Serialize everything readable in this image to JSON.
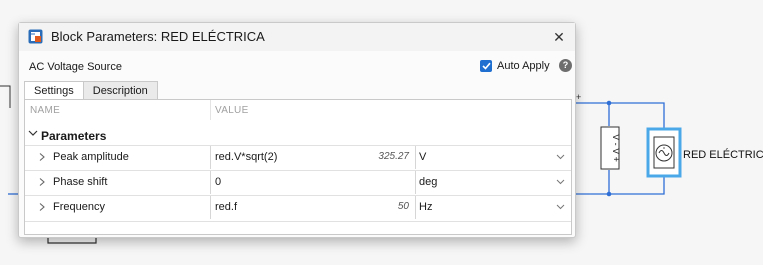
{
  "window": {
    "title": "Block Parameters: RED ELÉCTRICA",
    "block_type": "AC Voltage Source",
    "auto_apply_label": "Auto Apply",
    "auto_apply_checked": true
  },
  "tabs": [
    {
      "label": "Settings",
      "active": true
    },
    {
      "label": "Description",
      "active": false
    }
  ],
  "table": {
    "col_name": "NAME",
    "col_value": "VALUE",
    "group_label": "Parameters",
    "rows": [
      {
        "label": "Peak amplitude",
        "value": "red.V*sqrt(2)",
        "evaluated": "325.27",
        "unit": "V"
      },
      {
        "label": "Phase shift",
        "value": "0",
        "evaluated": "",
        "unit": "deg"
      },
      {
        "label": "Frequency",
        "value": "red.f",
        "evaluated": "50",
        "unit": "Hz"
      }
    ]
  },
  "diagram": {
    "block_label": "RED ELÉCTRICA",
    "sensor_text": "V - V +",
    "wire_color": "#2f6fd6",
    "selection_color": "#4aa8e8"
  },
  "colors": {
    "accent": "#1f6fd1"
  },
  "icons": [
    "block-icon",
    "close-icon",
    "check-icon",
    "help-icon",
    "chevron-down-icon",
    "chevron-right-icon",
    "ac-source-icon"
  ]
}
